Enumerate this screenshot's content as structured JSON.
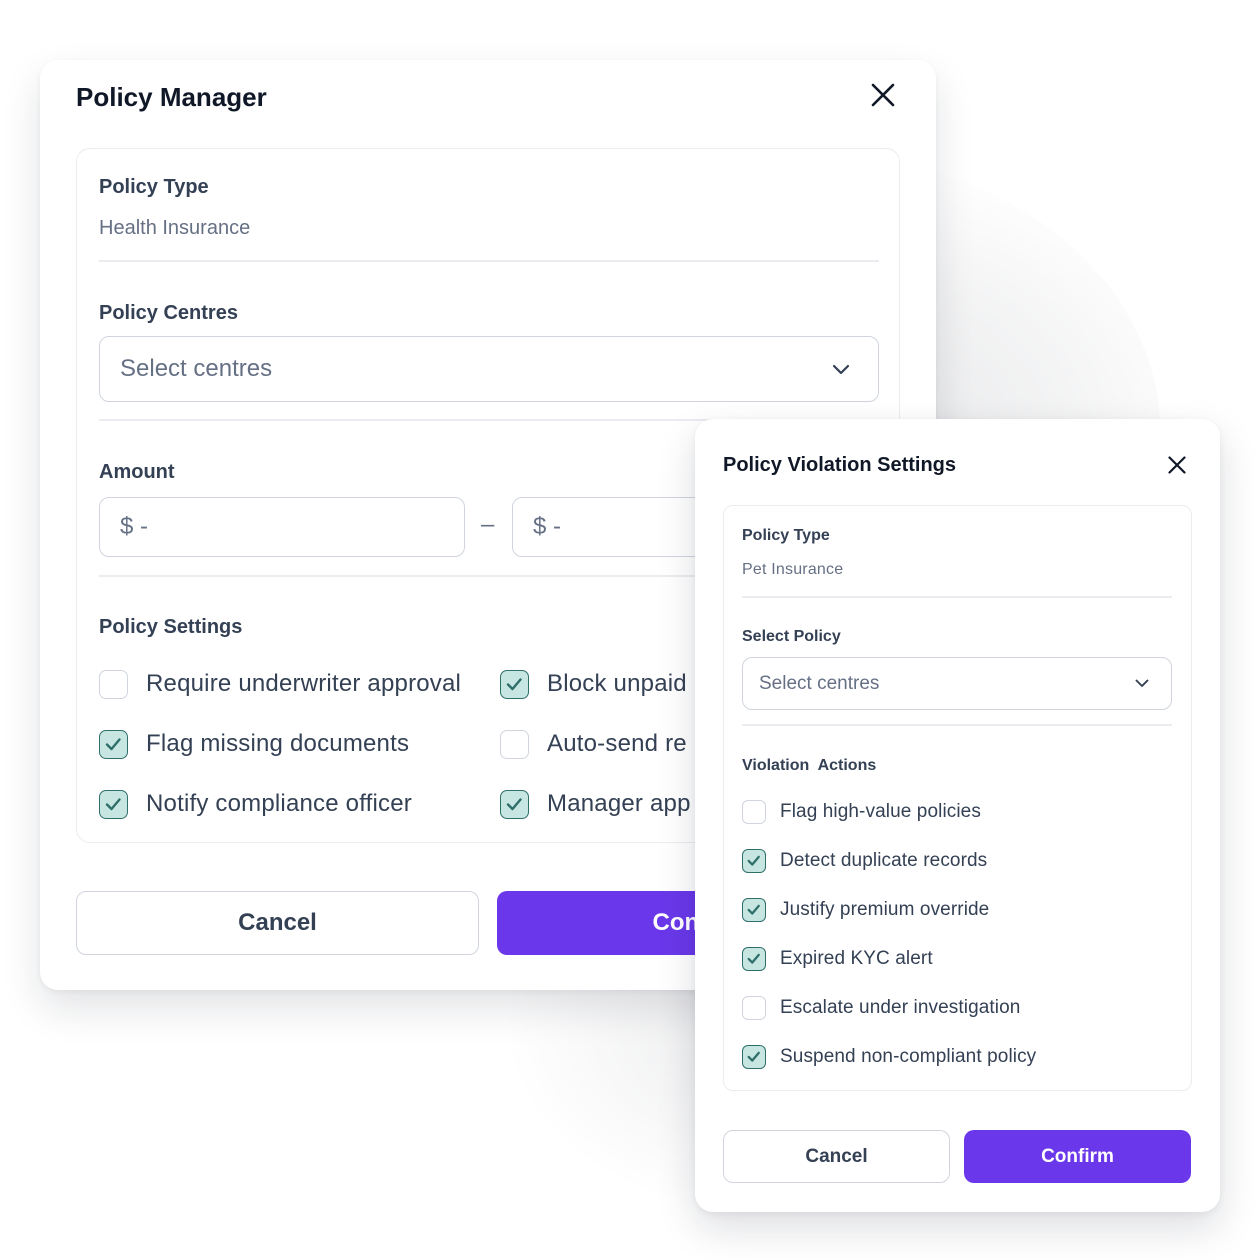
{
  "main": {
    "title": "Policy Manager",
    "policy_type": {
      "label": "Policy Type",
      "value": "Health Insurance"
    },
    "policy_centres": {
      "label": "Policy Centres",
      "placeholder": "Select centres"
    },
    "amount": {
      "label": "Amount",
      "min_placeholder": "$ -",
      "separator": "–",
      "max_placeholder": "$ -"
    },
    "settings": {
      "label": "Policy Settings",
      "items": [
        {
          "label": "Require underwriter approval",
          "checked": false
        },
        {
          "label": "Block unpaid",
          "checked": true
        },
        {
          "label": "Flag missing documents",
          "checked": true
        },
        {
          "label": "Auto-send re",
          "checked": false
        },
        {
          "label": "Notify compliance officer",
          "checked": true
        },
        {
          "label": "Manager app",
          "checked": true
        }
      ]
    },
    "cancel_label": "Cancel",
    "confirm_label": "Confirm"
  },
  "violation": {
    "title": "Policy Violation Settings",
    "policy_type": {
      "label": "Policy Type",
      "value": "Pet Insurance"
    },
    "select_policy": {
      "label": "Select Policy",
      "placeholder": "Select centres"
    },
    "actions": {
      "label": "Violation  Actions",
      "items": [
        {
          "label": "Flag high-value policies",
          "checked": false
        },
        {
          "label": "Detect duplicate records",
          "checked": true
        },
        {
          "label": "Justify premium override",
          "checked": true
        },
        {
          "label": "Expired KYC alert",
          "checked": true
        },
        {
          "label": "Escalate under investigation",
          "checked": false
        },
        {
          "label": "Suspend non-compliant policy",
          "checked": true
        }
      ]
    },
    "cancel_label": "Cancel",
    "confirm_label": "Confirm"
  },
  "colors": {
    "accent": "#6a38ea",
    "check_fill": "#c7e6e2",
    "check_stroke": "#2f6f6a",
    "border": "#d0d5dd"
  },
  "icons": {
    "close": "close-icon",
    "dropdown": "chevron-down-icon",
    "check": "check-icon"
  }
}
